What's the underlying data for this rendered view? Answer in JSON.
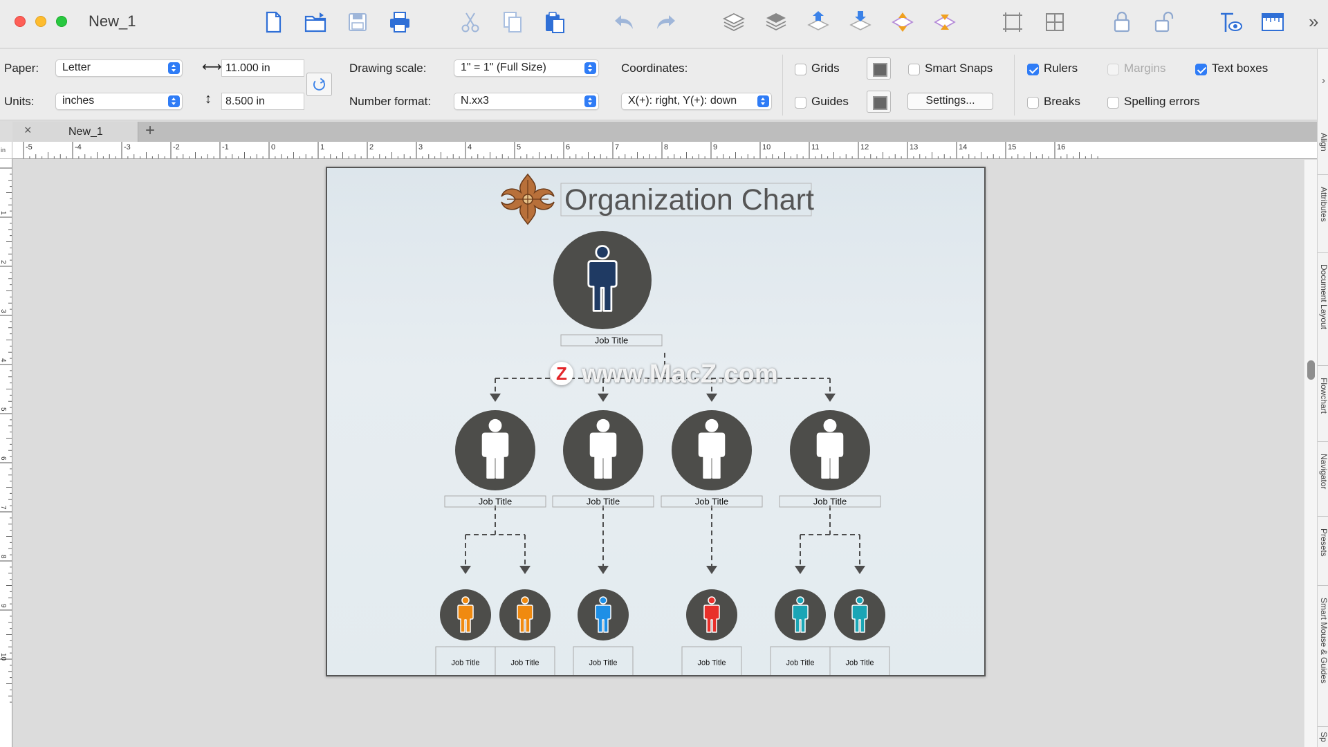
{
  "window": {
    "title": "New_1"
  },
  "toolbar": {
    "buttons": [
      "new-document-icon",
      "open-folder-icon",
      "save-icon",
      "print-icon",
      "cut-icon",
      "copy-icon",
      "paste-icon",
      "undo-icon",
      "redo-icon",
      "layers-icon",
      "layers-stack-icon",
      "bring-forward-icon",
      "send-backward-icon",
      "bring-to-front-icon",
      "send-to-back-icon",
      "group-icon",
      "ungroup-icon",
      "lock-icon",
      "unlock-icon",
      "view-icon",
      "ruler-icon"
    ],
    "overflow": "»"
  },
  "inspector": {
    "paper_label": "Paper:",
    "paper_value": "Letter",
    "units_label": "Units:",
    "units_value": "inches",
    "width_value": "11.000 in",
    "height_value": "8.500 in",
    "drawing_scale_label": "Drawing scale:",
    "drawing_scale_value": "1\" = 1\"   (Full Size)",
    "number_format_label": "Number format:",
    "number_format_value": "N.xx3",
    "coordinates_label": "Coordinates:",
    "coordinates_value": "X(+): right, Y(+): down",
    "grids": {
      "label": "Grids",
      "checked": false
    },
    "guides": {
      "label": "Guides",
      "checked": false
    },
    "smart_snaps": {
      "label": "Smart Snaps",
      "checked": false
    },
    "settings_label": "Settings...",
    "rulers": {
      "label": "Rulers",
      "checked": true
    },
    "margins": {
      "label": "Margins",
      "checked": false,
      "enabled": false
    },
    "text_boxes": {
      "label": "Text boxes",
      "checked": true
    },
    "breaks": {
      "label": "Breaks",
      "checked": false
    },
    "spelling_errors": {
      "label": "Spelling errors",
      "checked": false
    }
  },
  "tabs": [
    {
      "label": "New_1",
      "close": "×"
    }
  ],
  "tab_add": "+",
  "ruler": {
    "unit": "in",
    "h_labels": [
      "-5",
      "-4",
      "-3",
      "-2",
      "-1",
      "0",
      "1",
      "2",
      "3",
      "4",
      "5",
      "6",
      "7",
      "8",
      "9",
      "10",
      "11",
      "12",
      "13",
      "14",
      "15",
      "16"
    ],
    "v_labels": [
      "1",
      "2",
      "3",
      "4",
      "5",
      "6",
      "7",
      "8",
      "9",
      "10"
    ]
  },
  "side_panels": {
    "chevron": "›",
    "tabs": [
      "Align",
      "Attributes",
      "Document Layout",
      "Flowchart",
      "Navigator",
      "Presets",
      "Smart Mouse & Guides",
      "Sp"
    ]
  },
  "org_chart": {
    "title": "Organization Chart",
    "top": {
      "title": "Job Title",
      "color": "#1f3a63"
    },
    "managers": [
      {
        "title": "Job Title",
        "color": "#ffffff"
      },
      {
        "title": "Job Title",
        "color": "#ffffff"
      },
      {
        "title": "Job Title",
        "color": "#ffffff"
      },
      {
        "title": "Job Title",
        "color": "#ffffff"
      }
    ],
    "staff": [
      {
        "title": "Job Title",
        "color": "#f08a10",
        "manager": 0
      },
      {
        "title": "Job Title",
        "color": "#f08a10",
        "manager": 0
      },
      {
        "title": "Job Title",
        "color": "#1e8fe6",
        "manager": 1
      },
      {
        "title": "Job Title",
        "color": "#e8302b",
        "manager": 2
      },
      {
        "title": "Job Title",
        "color": "#1aa5b5",
        "manager": 3
      },
      {
        "title": "Job Title",
        "color": "#1aa5b5",
        "manager": 3
      }
    ],
    "circle_color": "#4d4d4a"
  },
  "watermark": {
    "badge": "Z",
    "text": "www.MacZ.com"
  }
}
